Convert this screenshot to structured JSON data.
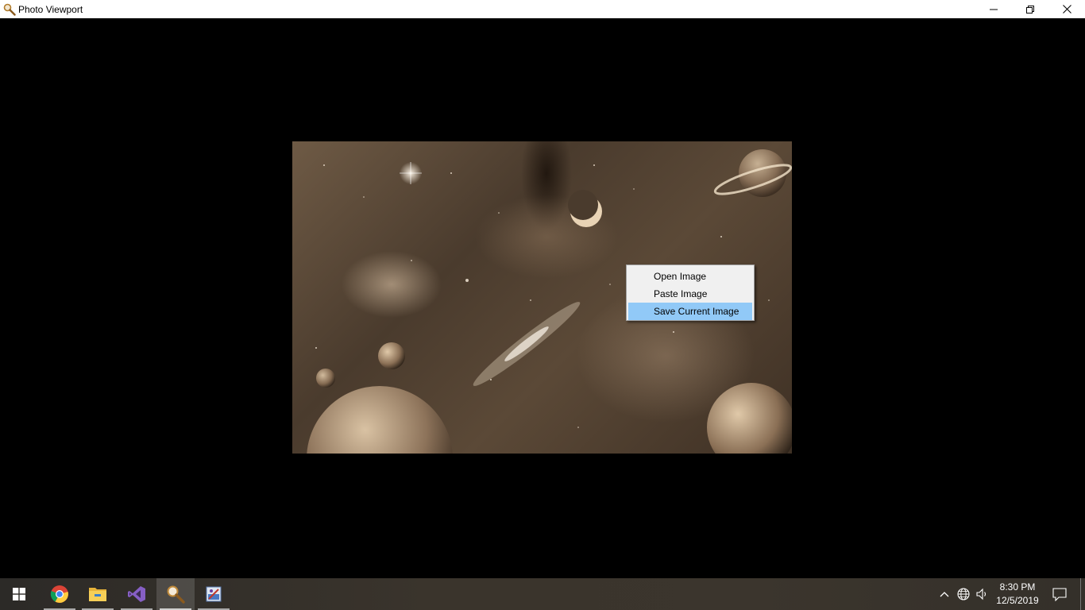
{
  "window": {
    "title": "Photo Viewport",
    "icon": "magnifier-icon",
    "controls": [
      "minimize-icon",
      "restore-icon",
      "close-icon"
    ]
  },
  "context_menu": {
    "items": [
      {
        "label": "Open Image",
        "highlighted": false
      },
      {
        "label": "Paste Image",
        "highlighted": false
      },
      {
        "label": "Save Current Image",
        "highlighted": true
      }
    ]
  },
  "taskbar": {
    "apps": [
      {
        "name": "windows-start-icon"
      },
      {
        "name": "chrome-icon"
      },
      {
        "name": "file-explorer-icon"
      },
      {
        "name": "visual-studio-icon"
      },
      {
        "name": "photo-viewport-icon",
        "active": true
      },
      {
        "name": "paint-icon"
      }
    ],
    "tray": [
      "chevron-up-icon",
      "network-globe-icon",
      "volume-icon",
      "notification-icon"
    ],
    "clock": {
      "time": "8:30 PM",
      "date": "12/5/2019"
    }
  },
  "colors": {
    "titlebar": "#ffffff",
    "viewport": "#000000",
    "menu_bg": "#f0f0f0",
    "menu_highlight": "#91c9f7",
    "taskbar": "#3a342c"
  }
}
